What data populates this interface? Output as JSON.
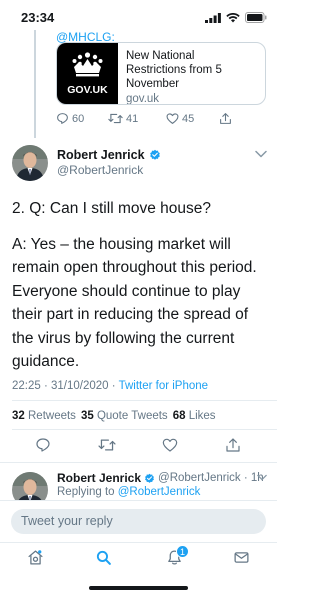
{
  "status_bar": {
    "time": "23:34"
  },
  "previous_tweet": {
    "handle_fragment": "@MHCLG:",
    "link_card": {
      "thumb_text": "GOV.UK",
      "title": "New National Restrictions from 5 November",
      "domain": "gov.uk"
    },
    "actions": {
      "replies": "60",
      "retweets": "41",
      "likes": "45"
    }
  },
  "main_tweet": {
    "author_name": "Robert Jenrick",
    "author_handle": "@RobertJenrick",
    "question": "2. Q: Can I still move house?",
    "answer": "A: Yes – the housing market will remain open throughout this period. Everyone should continue to play their part in reducing the spread of the virus by following the current guidance.",
    "timestamp": "22:25 · 31/10/2020 · ",
    "source": "Twitter for iPhone",
    "stats": {
      "retweets_count": "32",
      "retweets_label": "Retweets",
      "quotes_count": "35",
      "quotes_label": "Quote Tweets",
      "likes_count": "68",
      "likes_label": "Likes"
    }
  },
  "reply_tweet": {
    "author_name": "Robert Jenrick",
    "author_handle": "@RobertJenrick · 1h",
    "replying_prefix": "Replying to ",
    "replying_handle": "@RobertJenrick"
  },
  "compose": {
    "placeholder": "Tweet your reply"
  },
  "tabbar": {
    "notification_count": "1"
  },
  "colors": {
    "accent": "#1da1f2",
    "verified": "#1da1f2",
    "secondary_text": "#657786"
  }
}
